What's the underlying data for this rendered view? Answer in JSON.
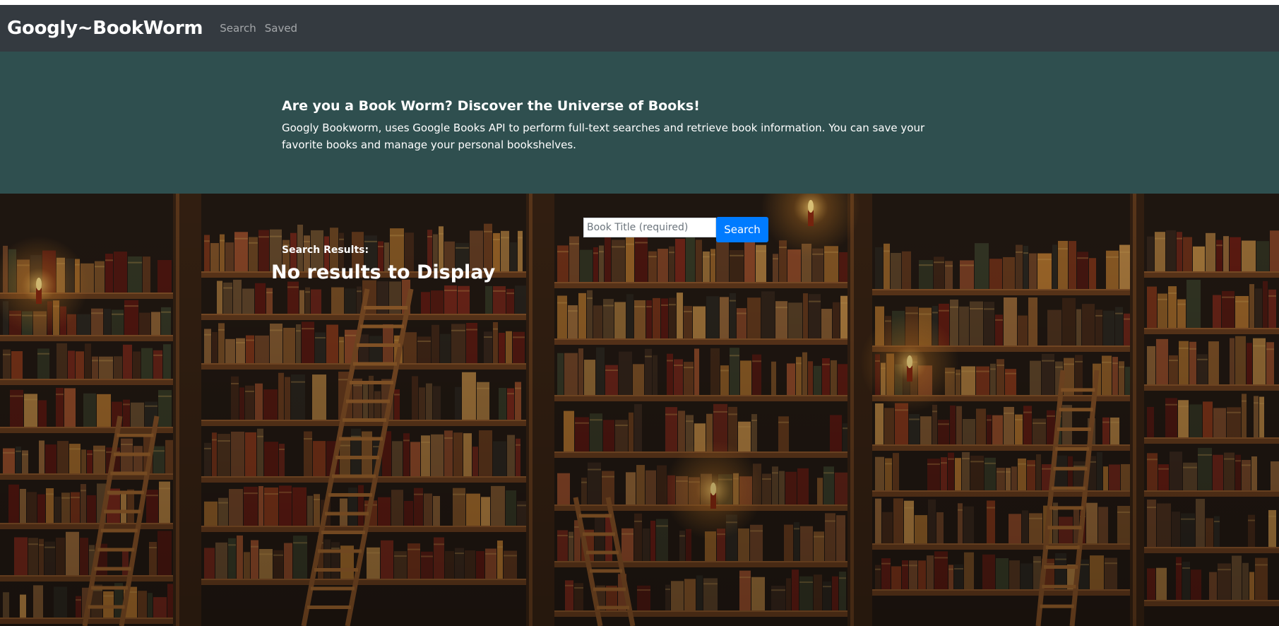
{
  "navbar": {
    "brand": "Googly~BookWorm",
    "links": [
      "Search",
      "Saved"
    ]
  },
  "hero": {
    "heading": "Are you a Book Worm? Discover the Universe of Books!",
    "description": "Googly Bookworm, uses Google Books API to perform full-text searches and retrieve book information. You can save your favorite books and manage your personal bookshelves."
  },
  "search": {
    "placeholder": "Book Title (required)",
    "value": "",
    "button_label": "Search"
  },
  "results": {
    "label": "Search Results:",
    "empty_message": "No results to Display"
  },
  "colors": {
    "navbar_bg": "#343a40",
    "hero_bg": "#2f4f4f",
    "button": "#007bff"
  }
}
